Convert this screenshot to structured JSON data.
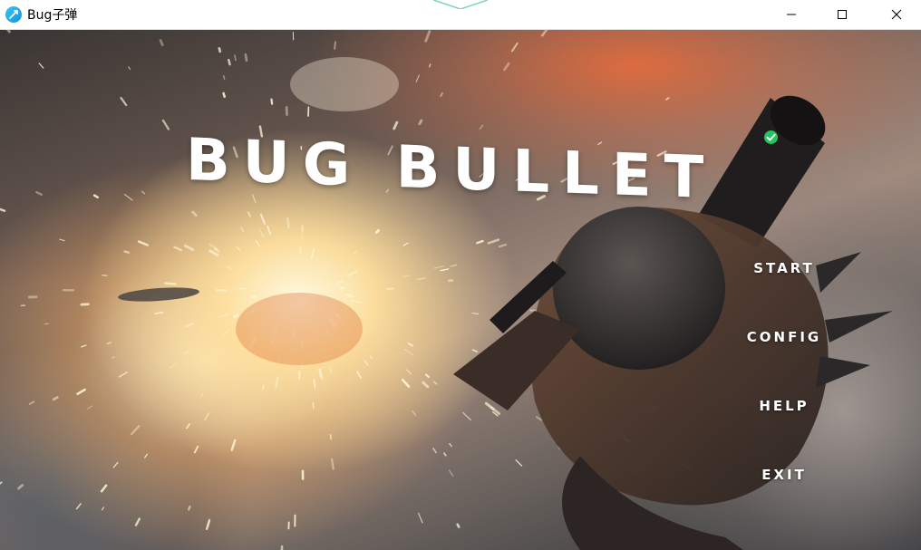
{
  "window": {
    "title": "Bug子弹",
    "icon": "bug-bullet-app-icon",
    "controls": [
      "minimize-icon",
      "maximize-icon",
      "close-icon"
    ]
  },
  "game": {
    "title": "BUG BULLET",
    "badge_icon": "green-check-icon",
    "badge_color": "#22c55e",
    "menu": [
      {
        "id": "start",
        "label": "START"
      },
      {
        "id": "config",
        "label": "CONFIG"
      },
      {
        "id": "help",
        "label": "HELP"
      },
      {
        "id": "exit",
        "label": "EXIT"
      }
    ]
  }
}
